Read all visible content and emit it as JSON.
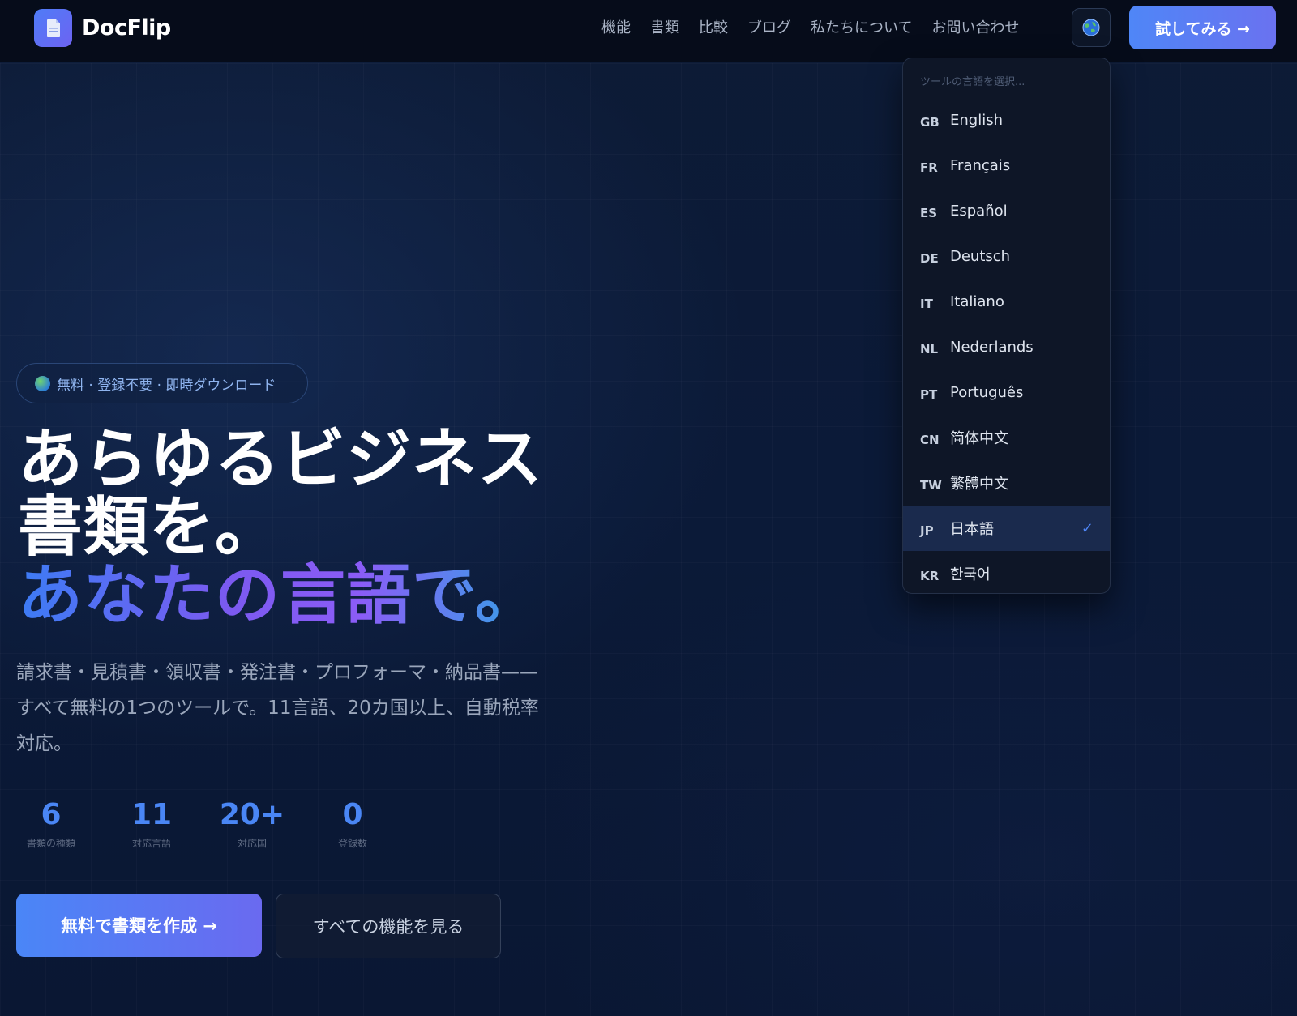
{
  "header": {
    "brand": "DocFlip",
    "nav": [
      "機能",
      "書類",
      "比較",
      "ブログ",
      "私たちについて",
      "お問い合わせ"
    ],
    "cta_label": "試してみる →"
  },
  "language_menu": {
    "placeholder": "ツールの言語を選択...",
    "items": [
      {
        "code": "GB",
        "label": "English"
      },
      {
        "code": "FR",
        "label": "Français"
      },
      {
        "code": "ES",
        "label": "Español"
      },
      {
        "code": "DE",
        "label": "Deutsch"
      },
      {
        "code": "IT",
        "label": "Italiano"
      },
      {
        "code": "NL",
        "label": "Nederlands"
      },
      {
        "code": "PT",
        "label": "Português"
      },
      {
        "code": "CN",
        "label": "简体中文"
      },
      {
        "code": "TW",
        "label": "繁體中文"
      },
      {
        "code": "JP",
        "label": "日本語"
      },
      {
        "code": "KR",
        "label": "한국어"
      }
    ],
    "selected": "JP",
    "check": "✓"
  },
  "hero": {
    "badge": "無料 · 登録不要 · 即時ダウンロード",
    "title_line1": "あらゆるビジネス",
    "title_line2": "書類を。",
    "title_line3": "あなたの言語で。",
    "description": "請求書・見積書・領収書・発注書・プロフォーマ・納品書——すべて無料の1つのツールで。11言語、20カ国以上、自動税率対応。",
    "stats": [
      {
        "value": "6",
        "label": "書類の種類"
      },
      {
        "value": "11",
        "label": "対応言語"
      },
      {
        "value": "20+",
        "label": "対応国"
      },
      {
        "value": "0",
        "label": "登録数"
      }
    ],
    "primary_button": "無料で書類を作成 →",
    "secondary_button": "すべての機能を見る"
  },
  "colors": {
    "accent": "#4f86f7",
    "accent2": "#6a6af0",
    "background": "#0c1a34",
    "header_bg": "#060c1a"
  }
}
